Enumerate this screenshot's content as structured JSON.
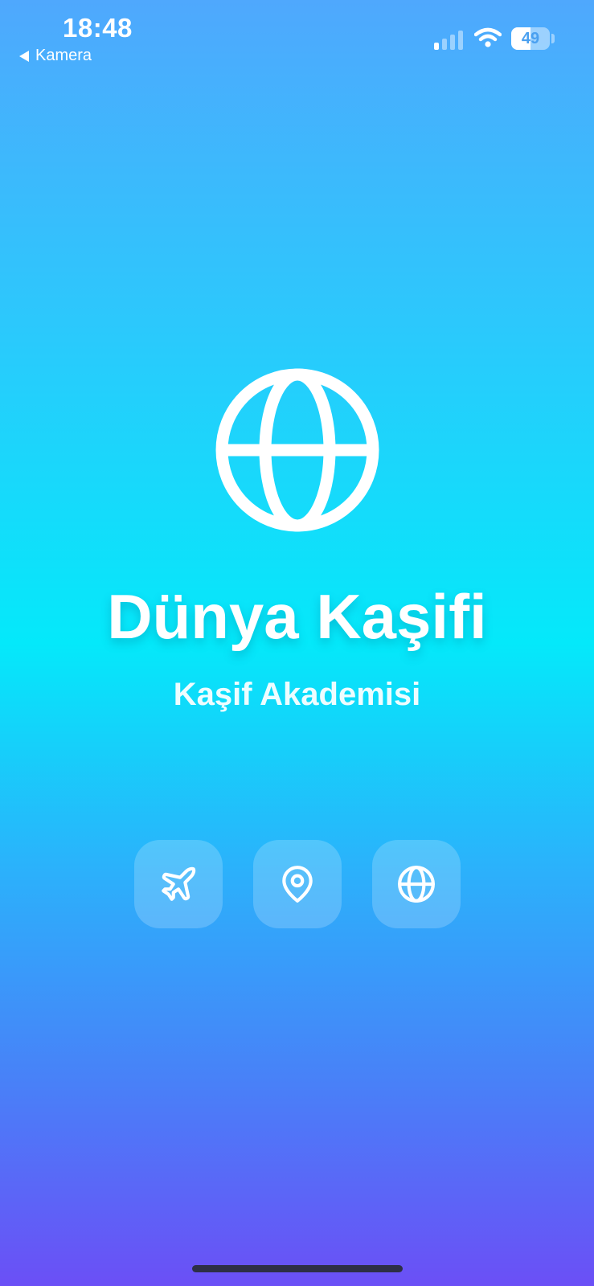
{
  "status_bar": {
    "time": "18:48",
    "back_label": "Kamera",
    "battery_level": "49",
    "signal_bars_active": 1,
    "signal_bars_total": 4
  },
  "hero": {
    "icon": "globe-icon",
    "title": "Dünya Kaşifi",
    "subtitle": "Kaşif Akademisi"
  },
  "features": [
    {
      "icon": "airplane-icon"
    },
    {
      "icon": "map-pin-icon"
    },
    {
      "icon": "globe-icon"
    }
  ],
  "colors": {
    "gradient_top": "#4fa8fd",
    "gradient_mid": "#04e9fa",
    "gradient_bottom": "#6b4ff6",
    "text": "#ffffff"
  }
}
